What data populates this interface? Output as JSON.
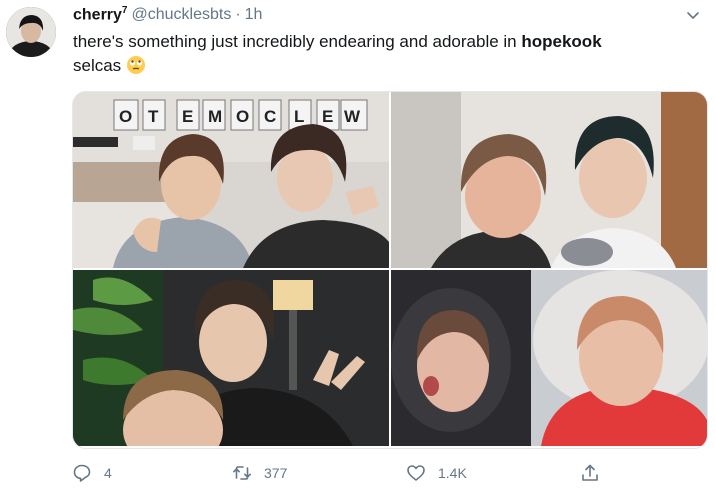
{
  "tweet": {
    "author_name": "cherry",
    "author_sup": "7",
    "handle": "@chucklesbts",
    "separator": "·",
    "time": "1h",
    "text_before": "there's something just incredibly endearing and adorable in ",
    "text_bold": "hopekook",
    "text_after": "selcas",
    "emoji": "rolling-eyes-emoji"
  },
  "media": {
    "photos": [
      {
        "sign_letters": [
          "W",
          "E",
          "L",
          "C",
          "O",
          "M",
          "E",
          "T",
          "O"
        ]
      },
      {},
      {},
      {}
    ]
  },
  "actions": {
    "reply_count": "4",
    "retweet_count": "377",
    "like_count": "1.4K"
  },
  "colors": {
    "text": "#14171a",
    "secondary": "#657786",
    "border": "#e1e8ed",
    "background": "#ffffff"
  },
  "icons": [
    "caret-down-icon",
    "reply-icon",
    "retweet-icon",
    "like-icon",
    "share-icon"
  ]
}
